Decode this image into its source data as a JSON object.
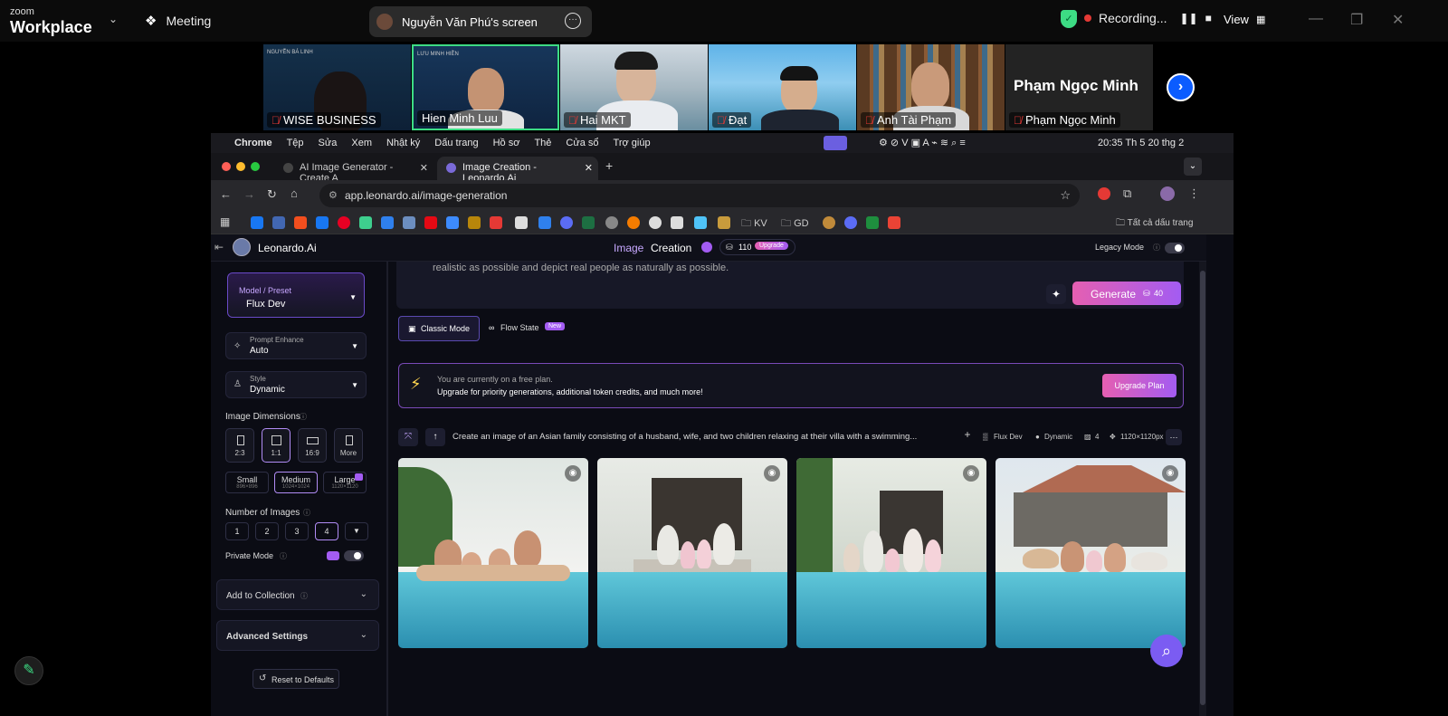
{
  "zoom": {
    "logo_small": "zoom",
    "logo_big": "Workplace",
    "meeting_label": "Meeting",
    "share_label": "Nguyễn Văn Phú's screen",
    "recording_label": "Recording...",
    "view_label": "View",
    "participants": [
      {
        "name": "WISE BUSINESS",
        "muted": true,
        "banner": "NGUYỄN BÁ LINH"
      },
      {
        "name": "Hien Minh Luu",
        "muted": false,
        "banner": "LƯU MINH HIỀN"
      },
      {
        "name": "Hai MKT",
        "muted": true
      },
      {
        "name": "Đạt",
        "muted": true
      },
      {
        "name": "Anh Tài Phạm",
        "muted": true
      },
      {
        "name": "Phạm Ngọc Minh",
        "muted": true,
        "avatar_text": "Phạm Ngọc Minh"
      }
    ]
  },
  "mac_menubar": {
    "items": [
      "Chrome",
      "Tệp",
      "Sửa",
      "Xem",
      "Nhật ký",
      "Dấu trang",
      "Hồ sơ",
      "Thẻ",
      "Cửa sổ",
      "Trợ giúp"
    ],
    "clock": "20:35 Th 5 20 thg 2"
  },
  "browser": {
    "tabs": [
      {
        "title": "AI Image Generator - Create A"
      },
      {
        "title": "Image Creation - Leonardo.Ai"
      }
    ],
    "url": "app.leonardo.ai/image-generation",
    "bookmarks_folders": [
      "KV",
      "GD"
    ],
    "all_bookmarks": "Tất cả dấu trang"
  },
  "leonardo": {
    "brand": "Leonardo.Ai",
    "page_title_a": "Image",
    "page_title_b": "Creation",
    "tokens": "110",
    "upgrade_badge": "Upgrade",
    "legacy_mode": "Legacy Mode",
    "model_label": "Model / Preset",
    "model_value": "Flux Dev",
    "prompt_enhance_label": "Prompt Enhance",
    "prompt_enhance_value": "Auto",
    "style_label": "Style",
    "style_value": "Dynamic",
    "image_dimensions": "Image Dimensions",
    "dims": [
      "2:3",
      "1:1",
      "16:9",
      "More"
    ],
    "sizes": [
      {
        "label": "Small",
        "sub": "896×896"
      },
      {
        "label": "Medium",
        "sub": "1024×1024"
      },
      {
        "label": "Large",
        "sub": "1120×1120"
      }
    ],
    "number_of_images": "Number of Images",
    "nums": [
      "1",
      "2",
      "3",
      "4"
    ],
    "private_mode": "Private Mode",
    "add_to_collection": "Add to Collection",
    "advanced_settings": "Advanced Settings",
    "reset": "Reset to Defaults",
    "prompt_tail": "realistic as possible and depict real people as naturally as possible.",
    "generate": "Generate",
    "generate_cost": "40",
    "classic_mode": "Classic Mode",
    "flow_state": "Flow State",
    "new_badge": "New",
    "free_plan_line1": "You are currently on a free plan.",
    "free_plan_line2": "Upgrade for priority generations, additional token credits, and much more!",
    "upgrade_plan": "Upgrade Plan",
    "gen_prompt": "Create an image of an Asian family consisting of a husband, wife, and two children relaxing at their villa with a swimming...",
    "gen_model": "Flux Dev",
    "gen_style": "Dynamic",
    "gen_count": "4",
    "gen_size": "1120×1120px"
  },
  "colors": {
    "accent": "#b18cf5",
    "pink": "#e55fb1",
    "zoom_green": "#3ddc84",
    "zoom_blue": "#0b5cff"
  }
}
